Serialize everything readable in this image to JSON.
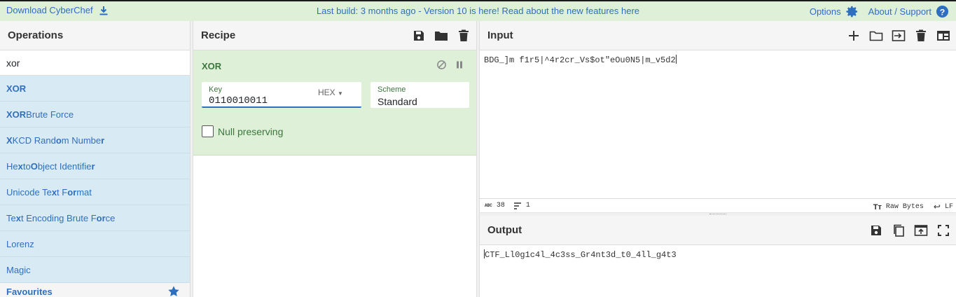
{
  "banner": {
    "download_label": "Download CyberChef",
    "announcement": "Last build: 3 months ago - Version 10 is here! Read about the new features here",
    "options_label": "Options",
    "about_label": "About / Support"
  },
  "operations": {
    "title": "Operations",
    "search_value": "xor",
    "items": [
      {
        "pre": "",
        "hl": "XOR",
        "post": ""
      },
      {
        "pre": "",
        "hl": "XOR",
        "post": " Brute Force"
      },
      {
        "pre": "",
        "hl": "X",
        "post": "KCD Rand",
        "hl2": "o",
        "post2": "m Numbe",
        "hl3": "r",
        "post3": ""
      },
      {
        "pre": "He",
        "hl": "x",
        "post": " to ",
        "hl2": "O",
        "post2": "bject Identifie",
        "hl3": "r",
        "post3": ""
      },
      {
        "pre": "Unicode Te",
        "hl": "x",
        "post": "t F",
        "hl2": "or",
        "post2": "mat",
        "hl3": "",
        "post3": ""
      },
      {
        "pre": "Te",
        "hl": "x",
        "post": "t Encoding Brute F",
        "hl2": "or",
        "post2": "ce",
        "hl3": "",
        "post3": ""
      },
      {
        "pre": "Lorenz",
        "hl": "",
        "post": ""
      },
      {
        "pre": "Magic",
        "hl": "",
        "post": ""
      }
    ],
    "favourites_label": "Favourites"
  },
  "recipe": {
    "title": "Recipe",
    "op_name": "XOR",
    "key_label": "Key",
    "key_value": "0110010011",
    "key_format": "HEX",
    "scheme_label": "Scheme",
    "scheme_value": "Standard",
    "null_label": "Null preserving"
  },
  "input": {
    "title": "Input",
    "text": "BDG_]m f1r5|^4r2cr_Vs$ot\"eOu0N5|m_v5d2",
    "length": "38",
    "lines": "1",
    "encoding": "Raw Bytes",
    "eol": "LF"
  },
  "output": {
    "title": "Output",
    "text": "CTF_Ll0g1c4l_4c3ss_Gr4nt3d_t0_4ll_g4t3"
  },
  "colors": {
    "banner_bg": "#dff0d8",
    "link_blue": "#2f6fbf",
    "op_item_bg": "#d8ebf5",
    "recipe_op_bg": "#dff0d8",
    "recipe_text_green": "#3c763d"
  },
  "icons": [
    "download-icon",
    "gear-icon",
    "help-icon",
    "save-icon",
    "folder-icon",
    "trash-icon",
    "plus-icon",
    "input-to-file-icon",
    "layout-icon",
    "copy-icon",
    "replace-input-icon",
    "fullscreen-icon",
    "disable-icon",
    "pause-icon",
    "star-icon"
  ]
}
